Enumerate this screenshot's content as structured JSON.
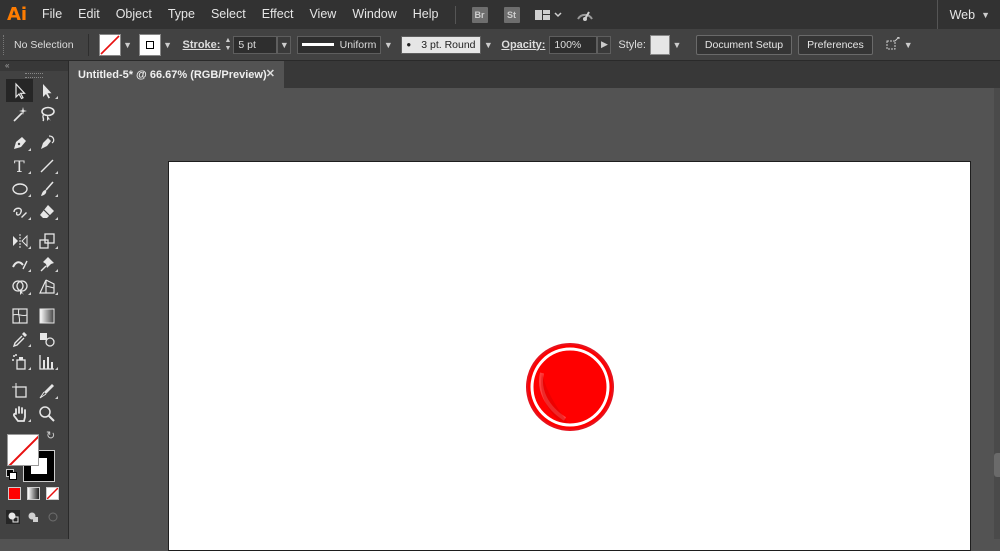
{
  "app": {
    "logo": "Ai",
    "workspace": "Web"
  },
  "menu": [
    "File",
    "Edit",
    "Object",
    "Type",
    "Select",
    "Effect",
    "View",
    "Window",
    "Help"
  ],
  "menubar_badges": {
    "bridge": "Br",
    "stock": "St"
  },
  "control_bar": {
    "selection_state": "No Selection",
    "stroke_label": "Stroke:",
    "stroke_weight": "5 pt",
    "profile": "Uniform",
    "brush": "3 pt. Round",
    "opacity_label": "Opacity:",
    "opacity": "100%",
    "style_label": "Style:",
    "document_setup": "Document Setup",
    "preferences": "Preferences"
  },
  "document": {
    "tab_title": "Untitled-5* @ 66.67% (RGB/Preview)",
    "close_glyph": "✕",
    "artwork": {
      "fill": "#ff0000",
      "outer_ring": "#e5131e",
      "inner_ring": "#ffffff"
    }
  },
  "tool_panel": {
    "collapse_glyph": "«",
    "tools": [
      [
        "selection-tool-icon",
        "direct-selection-tool-icon"
      ],
      [
        "magic-wand-tool-icon",
        "lasso-tool-icon"
      ],
      [
        "pen-tool-icon",
        "curvature-tool-icon"
      ],
      [
        "type-tool-icon",
        "line-segment-tool-icon"
      ],
      [
        "ellipse-tool-icon",
        "paintbrush-tool-icon"
      ],
      [
        "shaper-tool-icon",
        "eraser-tool-icon"
      ],
      [
        "reflect-tool-icon",
        "scale-tool-icon"
      ],
      [
        "width-tool-icon",
        "puppet-warp-tool-icon"
      ],
      [
        "shape-builder-tool-icon",
        "perspective-grid-tool-icon"
      ],
      [
        "mesh-tool-icon",
        "gradient-tool-icon"
      ],
      [
        "eyedropper-tool-icon",
        "blend-tool-icon"
      ],
      [
        "symbol-sprayer-tool-icon",
        "column-graph-tool-icon"
      ],
      [
        "artboard-tool-icon",
        "slice-tool-icon"
      ],
      [
        "hand-tool-icon",
        "zoom-tool-icon"
      ]
    ],
    "fill_color": "none",
    "stroke_color": "#000000"
  }
}
